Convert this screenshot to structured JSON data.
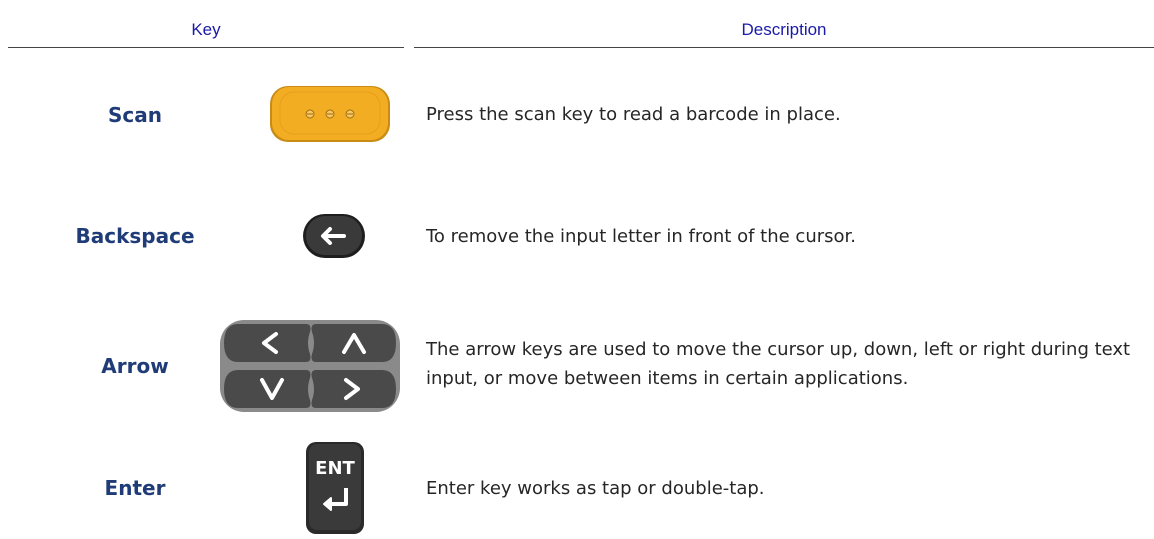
{
  "header": {
    "key_col": "Key",
    "desc_col": "Description"
  },
  "rows": [
    {
      "key": "Scan",
      "description": "Press the scan key to read a barcode in place.",
      "icon": "scan-key-icon"
    },
    {
      "key": "Backspace",
      "description": "To remove the input letter in front of the cursor.",
      "icon": "backspace-key-icon"
    },
    {
      "key": "Arrow",
      "description": "The arrow keys are used to move the cursor up, down, left or right during text input, or move between items in certain applications.",
      "icon": "arrow-keys-icon"
    },
    {
      "key": "Enter",
      "description": "Enter key works as tap or double-tap.",
      "icon": "enter-key-icon",
      "key_cap_text": "ENT"
    }
  ],
  "colors": {
    "header_text": "#1a1aa8",
    "key_label": "#1f3b78",
    "scan_key": "#f2ad23",
    "dark_key": "#3a3a3a"
  }
}
